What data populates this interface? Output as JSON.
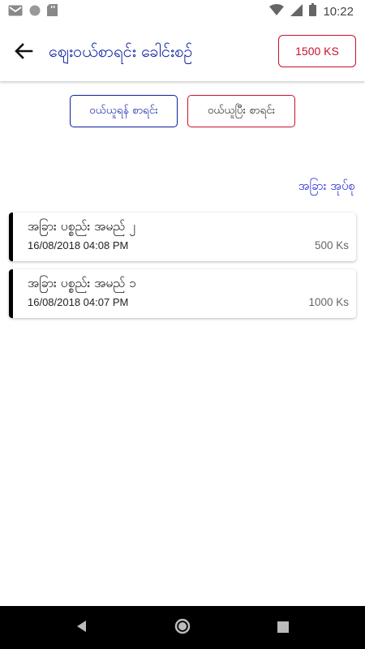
{
  "status_bar": {
    "time": "10:22",
    "left_icons": [
      "gmail-icon",
      "circle-icon",
      "sd-card-icon"
    ],
    "right_icons": [
      "wifi-icon",
      "signal-icon",
      "battery-icon"
    ]
  },
  "app_bar": {
    "title": "ဈေးဝယ်စာရင်း ခေါင်းစဉ်",
    "balance_label": "1500 KS"
  },
  "tabs": [
    {
      "label": "ဝယ်ယူရန် စာရင်း"
    },
    {
      "label": "ဝယ်ယူပြီး စာရင်း"
    }
  ],
  "group_label": "အခြား အုပ်စု",
  "items": [
    {
      "name": "အခြား ပစ္စည်း အမည် ၂",
      "date": "16/08/2018 04:08 PM",
      "price": "500 Ks"
    },
    {
      "name": "အခြား ပစ္စည်း အမည် ၁",
      "date": "16/08/2018 04:07 PM",
      "price": "1000 Ks"
    }
  ],
  "colors": {
    "primary": "#0b1fa0",
    "accent": "#c8102e",
    "link": "#1a22d6"
  }
}
